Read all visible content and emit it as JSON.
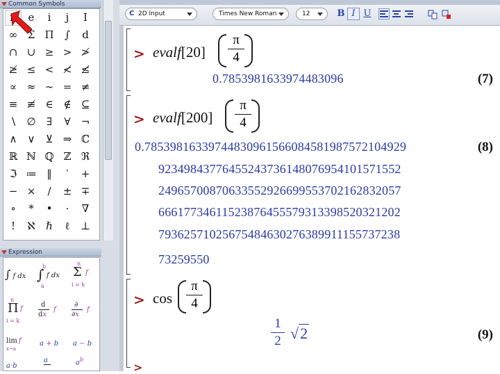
{
  "palettes": {
    "common_symbols": {
      "title": "Common Symbols",
      "rows": [
        [
          "π",
          "e",
          "i",
          "j",
          "I"
        ],
        [
          "∞",
          "Σ",
          "Π",
          "∫",
          "d"
        ],
        [
          "∩",
          "∪",
          "≥",
          ">",
          "≯"
        ],
        [
          "≱",
          "≤",
          "<",
          "≮",
          "≰"
        ],
        [
          "∝",
          "≈",
          "∼",
          "=",
          "≠"
        ],
        [
          "≡",
          "≢",
          "∈",
          "∉",
          "⊆"
        ],
        [
          "∖",
          "∅",
          "∃",
          "∀",
          "¬"
        ],
        [
          "∧",
          "∨",
          "⊻",
          "⇒",
          "ℂ"
        ],
        [
          "ℝ",
          "ℕ",
          "ℚ",
          "ℤ",
          "ℜ"
        ],
        [
          "ℑ",
          "≔",
          "‖",
          "′",
          "+"
        ],
        [
          "−",
          "×",
          "/",
          "±",
          "∓"
        ],
        [
          "∘",
          "*",
          "•",
          "·",
          "∇"
        ],
        [
          "!",
          "ℵ",
          "ℏ",
          "ℓ",
          "⊥"
        ]
      ]
    },
    "expression": {
      "title": "Expression",
      "items": [
        {
          "name": "integral-template",
          "text": "∫ f dx"
        },
        {
          "name": "definite-integral-template",
          "text": "∫ab f dx"
        },
        {
          "name": "sum-template",
          "text": "Σ i=k..n f"
        },
        {
          "name": "product-template",
          "text": "Π i=k..n f"
        },
        {
          "name": "derivative-template",
          "text": "d/dx f"
        },
        {
          "name": "partial-derivative-template",
          "text": "∂/∂x f"
        },
        {
          "name": "limit-template",
          "text": "lim x→a f"
        },
        {
          "name": "addition-template",
          "text": "a + b"
        },
        {
          "name": "subtraction-template",
          "text": "a − b"
        },
        {
          "name": "multiplication-template",
          "text": "a·b"
        },
        {
          "name": "fraction-template",
          "text": "a/b"
        },
        {
          "name": "power-template",
          "text": "a^b"
        }
      ]
    }
  },
  "toolbar": {
    "mode": "2D Input",
    "font": "Times New Roman",
    "size": "12",
    "bold": "B",
    "italic": "I",
    "underline": "U"
  },
  "worksheet": {
    "inputs": [
      {
        "func": "evalf",
        "arg": "20",
        "num": "π",
        "den": "4"
      },
      {
        "func": "evalf",
        "arg": "200",
        "num": "π",
        "den": "4"
      },
      {
        "func": "cos",
        "num": "π",
        "den": "4"
      }
    ],
    "outputs": [
      {
        "label": "(7)",
        "lines": [
          "0.7853981633974483096"
        ]
      },
      {
        "label": "(8)",
        "lines": [
          "0.78539816339744830961566084581987572104929",
          "92349843776455243736148076954101571552",
          "24965700870633552926699553702162832057",
          "66617734611523876455579313398520321202",
          "79362571025675484630276389911155737238",
          "73259550"
        ]
      },
      {
        "label": "(9)",
        "num": "1",
        "den": "2",
        "radicand": "2",
        "radical": "√"
      }
    ]
  },
  "colors": {
    "prompt": "#9c1a1a",
    "output": "#2a3aa8",
    "cursor": "#e31b1b"
  }
}
